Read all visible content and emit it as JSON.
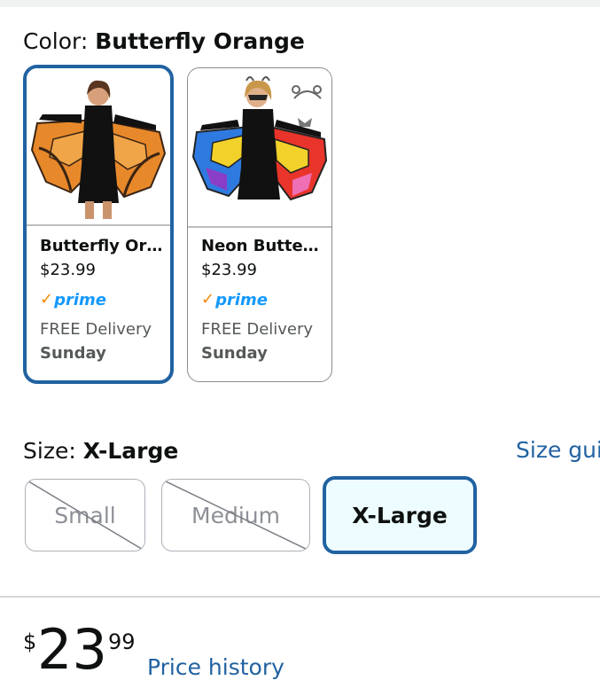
{
  "color": {
    "label": "Color:",
    "selected_value": "Butterfly Orange",
    "options": [
      {
        "title": "Butterfly Or…",
        "price": "$23.99",
        "prime": "prime",
        "delivery": "FREE Delivery",
        "delivery_day": "Sunday",
        "wing_colors": [
          "#e7892b",
          "#f0a548",
          "#3b2413"
        ]
      },
      {
        "title": "Neon Butte…",
        "price": "$23.99",
        "prime": "prime",
        "delivery": "FREE Delivery",
        "delivery_day": "Sunday",
        "wing_colors": [
          "#2f7ae0",
          "#f2d22a",
          "#e8342a",
          "#8a3ec8",
          "#ef6fb5"
        ]
      }
    ]
  },
  "size": {
    "label": "Size:",
    "selected_value": "X-Large",
    "guide_link": "Size gui",
    "options": [
      {
        "label": "Small",
        "available": false
      },
      {
        "label": "Medium",
        "available": false
      },
      {
        "label": "X-Large",
        "available": true
      }
    ]
  },
  "price": {
    "symbol": "$",
    "whole": "23",
    "fraction": "99",
    "history_link": "Price history"
  },
  "colors": {
    "accent": "#2162a1",
    "selected_bg": "#edfdff",
    "prime_blue": "#1399ff",
    "prime_check": "#f08804"
  }
}
